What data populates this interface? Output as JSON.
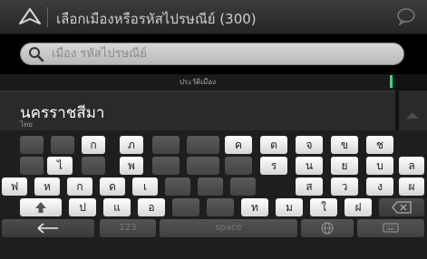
{
  "titlebar": {
    "title": "เลือกเมืองหรือรหัสไปรษณีย์ (300)",
    "icons": {
      "nav": "navigation-arrow-icon",
      "chat": "speech-bubble-icon"
    }
  },
  "search": {
    "placeholder": "เมือง รหัสไปรษณีย์",
    "value": "",
    "icon": "search-icon"
  },
  "results": {
    "section_header": "ประวัติเมือง",
    "items": [
      {
        "name": "นครราชสีมา",
        "country": "ไทย"
      }
    ]
  },
  "keyboard": {
    "row1": [
      "",
      "",
      "ก",
      "ภ",
      "",
      "",
      "ค",
      "ต",
      "จ",
      "ข",
      "ช"
    ],
    "row2": [
      "",
      "ไ",
      "",
      "พ",
      "",
      "",
      "",
      "ร",
      "น",
      "ย",
      "บ",
      "ล"
    ],
    "row3": [
      "ฟ",
      "ห",
      "ก",
      "ด",
      "เ",
      "",
      "",
      "",
      "ส",
      "ว",
      "ง",
      "ผ"
    ],
    "row4": [
      "",
      "ป",
      "แ",
      "อ",
      "",
      "",
      "ท",
      "ม",
      "ใ",
      "ฝ"
    ],
    "numbers_label": "123",
    "space_label": "space",
    "icons": {
      "shift": "shift-arrow-icon",
      "backspace": "backspace-icon",
      "back": "back-arrow-icon",
      "language": "globe-icon",
      "hide": "keyboard-hide-icon"
    }
  },
  "colors": {
    "accent": "#3fd08a",
    "key_lit": "#ffffff",
    "key_dark": "#4e4e4e"
  }
}
